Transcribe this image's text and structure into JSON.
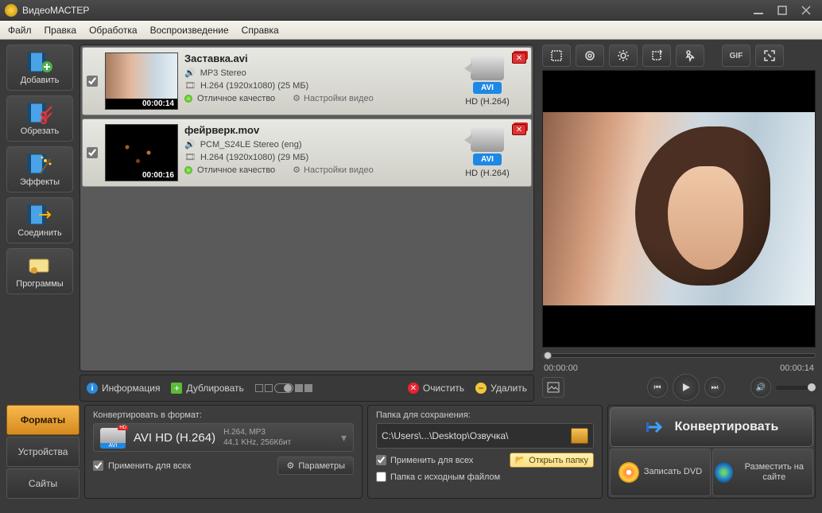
{
  "app": {
    "title": "ВидеоМАСТЕР"
  },
  "menu": [
    "Файл",
    "Правка",
    "Обработка",
    "Воспроизведение",
    "Справка"
  ],
  "sidebar": [
    {
      "label": "Добавить"
    },
    {
      "label": "Обрезать"
    },
    {
      "label": "Эффекты"
    },
    {
      "label": "Соединить"
    },
    {
      "label": "Программы"
    }
  ],
  "files": [
    {
      "name": "Заставка.avi",
      "dur": "00:00:14",
      "audio": "MP3 Stereo",
      "video": "H.264 (1920x1080) (25 МБ)",
      "quality": "Отличное качество",
      "settings": "Настройки видео",
      "fmt": "AVI",
      "target": "HD (H.264)",
      "hd": "HD",
      "thumb": "woman"
    },
    {
      "name": "фейрверк.mov",
      "dur": "00:00:16",
      "audio": "PCM_S24LE Stereo (eng)",
      "video": "H.264 (1920x1080) (29 МБ)",
      "quality": "Отличное качество",
      "settings": "Настройки видео",
      "fmt": "AVI",
      "target": "HD (H.264)",
      "hd": "HD",
      "thumb": "fire"
    }
  ],
  "listbar": {
    "info": "Информация",
    "dup": "Дублировать",
    "clear": "Очистить",
    "del": "Удалить"
  },
  "tools": {
    "gif": "GIF"
  },
  "preview": {
    "t0": "00:00:00",
    "t1": "00:00:14"
  },
  "tabs": {
    "formats": "Форматы",
    "devices": "Устройства",
    "sites": "Сайты"
  },
  "format": {
    "header": "Конвертировать в формат:",
    "name": "AVI HD (H.264)",
    "l1": "H.264, MP3",
    "l2": "44,1 KHz, 256Кбит",
    "apply": "Применить для всех",
    "params": "Параметры"
  },
  "save": {
    "header": "Папка для сохранения:",
    "path": "C:\\Users\\...\\Desktop\\Озвучка\\",
    "apply": "Применить для всех",
    "source": "Папка с исходным файлом",
    "open": "Открыть папку"
  },
  "actions": {
    "convert": "Конвертировать",
    "dvd": "Записать DVD",
    "site": "Разместить на сайте"
  }
}
